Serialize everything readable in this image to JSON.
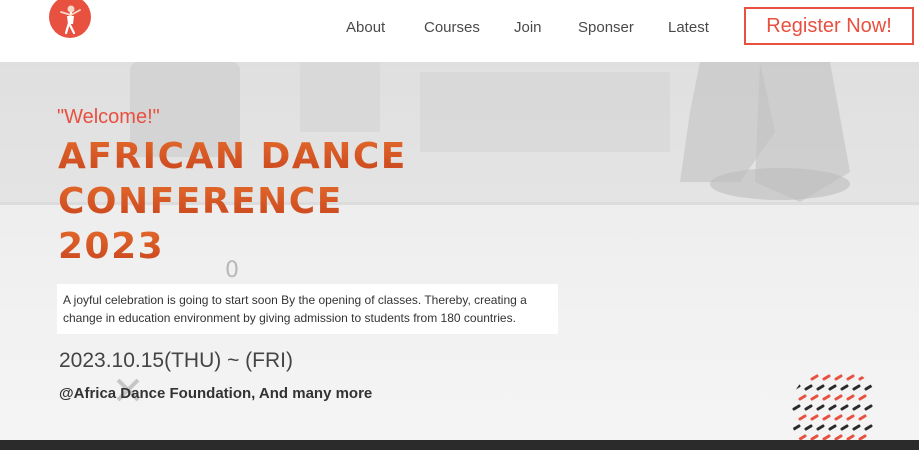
{
  "header": {
    "nav": [
      {
        "label": "About"
      },
      {
        "label": "Courses"
      },
      {
        "label": "Join"
      },
      {
        "label": "Sponser"
      },
      {
        "label": "Latest"
      }
    ],
    "register_label": "Register Now!"
  },
  "hero": {
    "welcome": "\"Welcome!\"",
    "title_lines": [
      "AFRICAN DANCE",
      "CONFERENCE",
      "2023"
    ],
    "description": "A joyful celebration is going to start soon By the opening of classes. Thereby, creating a change in education environment by giving admission to students from 180 countries.",
    "date": "2023.10.15(THU) ~ (FRI)",
    "venue": "@Africa Dance Foundation, And many more"
  },
  "colors": {
    "accent": "#e8503f",
    "title_gradient_top": "#e36a2b",
    "title_gradient_bottom": "#c8441e",
    "footer": "#2b2b2b"
  },
  "icons": {
    "logo": "dancer-logo-icon",
    "pattern": "dotted-pattern-icon"
  }
}
